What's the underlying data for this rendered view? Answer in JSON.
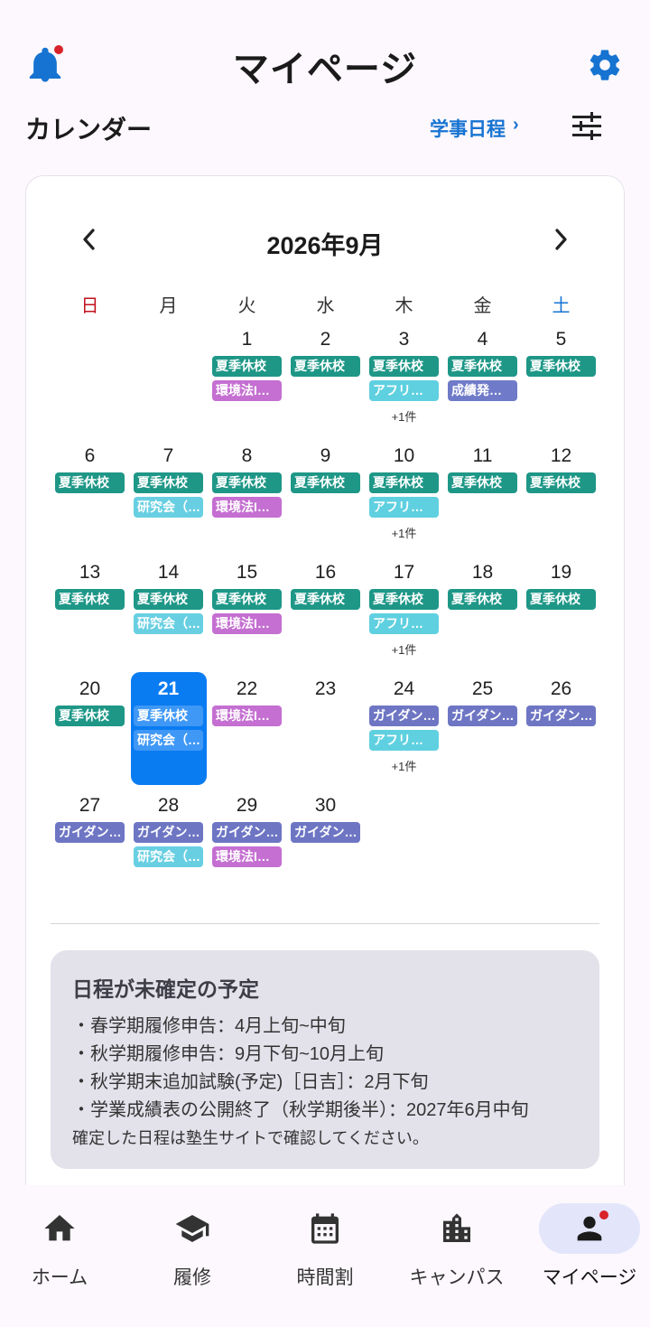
{
  "header": {
    "title": "マイページ"
  },
  "calendar": {
    "section_title": "カレンダー",
    "academic_link": "学事日程",
    "month_label": "2026年9月",
    "weekdays": [
      "日",
      "月",
      "火",
      "水",
      "木",
      "金",
      "土"
    ],
    "colors": {
      "natsu": "#1e9787",
      "kankyo": "#c46fd1",
      "afuri": "#5fd0e0",
      "kenkyu": "#68cfe2",
      "seiseki": "#6f7bc8",
      "guidance": "#6e76c4",
      "sunday": "#c1121f",
      "saturday": "#1673d1",
      "today": "#0a7cf2"
    },
    "days": {
      "1": {
        "num": "1",
        "events": [
          {
            "t": "夏季休校",
            "c": "natsu"
          },
          {
            "t": "環境法I…",
            "c": "kankyo"
          }
        ]
      },
      "2": {
        "num": "2",
        "events": [
          {
            "t": "夏季休校",
            "c": "natsu"
          }
        ]
      },
      "3": {
        "num": "3",
        "events": [
          {
            "t": "夏季休校",
            "c": "natsu"
          },
          {
            "t": "アフリ…",
            "c": "afuri"
          }
        ],
        "more": "+1件"
      },
      "4": {
        "num": "4",
        "events": [
          {
            "t": "夏季休校",
            "c": "natsu"
          },
          {
            "t": "成績発…",
            "c": "seiseki"
          }
        ]
      },
      "5": {
        "num": "5",
        "events": [
          {
            "t": "夏季休校",
            "c": "natsu"
          }
        ]
      },
      "6": {
        "num": "6",
        "events": [
          {
            "t": "夏季休校",
            "c": "natsu"
          }
        ]
      },
      "7": {
        "num": "7",
        "events": [
          {
            "t": "夏季休校",
            "c": "natsu"
          },
          {
            "t": "研究会（…",
            "c": "kenkyu"
          }
        ]
      },
      "8": {
        "num": "8",
        "events": [
          {
            "t": "夏季休校",
            "c": "natsu"
          },
          {
            "t": "環境法I…",
            "c": "kankyo"
          }
        ]
      },
      "9": {
        "num": "9",
        "events": [
          {
            "t": "夏季休校",
            "c": "natsu"
          }
        ]
      },
      "10": {
        "num": "10",
        "events": [
          {
            "t": "夏季休校",
            "c": "natsu"
          },
          {
            "t": "アフリ…",
            "c": "afuri"
          }
        ],
        "more": "+1件"
      },
      "11": {
        "num": "11",
        "events": [
          {
            "t": "夏季休校",
            "c": "natsu"
          }
        ]
      },
      "12": {
        "num": "12",
        "events": [
          {
            "t": "夏季休校",
            "c": "natsu"
          }
        ]
      },
      "13": {
        "num": "13",
        "events": [
          {
            "t": "夏季休校",
            "c": "natsu"
          }
        ]
      },
      "14": {
        "num": "14",
        "events": [
          {
            "t": "夏季休校",
            "c": "natsu"
          },
          {
            "t": "研究会（…",
            "c": "kenkyu"
          }
        ]
      },
      "15": {
        "num": "15",
        "events": [
          {
            "t": "夏季休校",
            "c": "natsu"
          },
          {
            "t": "環境法I…",
            "c": "kankyo"
          }
        ]
      },
      "16": {
        "num": "16",
        "events": [
          {
            "t": "夏季休校",
            "c": "natsu"
          }
        ]
      },
      "17": {
        "num": "17",
        "events": [
          {
            "t": "夏季休校",
            "c": "natsu"
          },
          {
            "t": "アフリ…",
            "c": "afuri"
          }
        ],
        "more": "+1件"
      },
      "18": {
        "num": "18",
        "events": [
          {
            "t": "夏季休校",
            "c": "natsu"
          }
        ]
      },
      "19": {
        "num": "19",
        "events": [
          {
            "t": "夏季休校",
            "c": "natsu"
          }
        ]
      },
      "20": {
        "num": "20",
        "events": [
          {
            "t": "夏季休校",
            "c": "natsu"
          }
        ]
      },
      "21": {
        "num": "21",
        "today": true,
        "events": [
          {
            "t": "夏季休校",
            "c": "today"
          },
          {
            "t": "研究会（…",
            "c": "today"
          }
        ]
      },
      "22": {
        "num": "22",
        "events": [
          {
            "t": "環境法I…",
            "c": "kankyo"
          }
        ]
      },
      "23": {
        "num": "23",
        "events": []
      },
      "24": {
        "num": "24",
        "events": [
          {
            "t": "ガイダン…",
            "c": "guidance"
          },
          {
            "t": "アフリ…",
            "c": "afuri"
          }
        ],
        "more": "+1件"
      },
      "25": {
        "num": "25",
        "events": [
          {
            "t": "ガイダン…",
            "c": "guidance"
          }
        ]
      },
      "26": {
        "num": "26",
        "events": [
          {
            "t": "ガイダン…",
            "c": "guidance"
          }
        ]
      },
      "27": {
        "num": "27",
        "events": [
          {
            "t": "ガイダン…",
            "c": "guidance"
          }
        ]
      },
      "28": {
        "num": "28",
        "events": [
          {
            "t": "ガイダン…",
            "c": "guidance"
          },
          {
            "t": "研究会（…",
            "c": "kenkyu"
          }
        ]
      },
      "29": {
        "num": "29",
        "events": [
          {
            "t": "ガイダン…",
            "c": "guidance"
          },
          {
            "t": "環境法I…",
            "c": "kankyo"
          }
        ]
      },
      "30": {
        "num": "30",
        "events": [
          {
            "t": "ガイダン…",
            "c": "guidance"
          }
        ]
      }
    }
  },
  "note": {
    "title": "日程が未確定の予定",
    "items": [
      "・春学期履修申告：4月上旬~中旬",
      "・秋学期履修申告：9月下旬~10月上旬",
      "・秋学期末追加試験(予定)［日吉］：2月下旬",
      "・学業成績表の公開終了（秋学期後半）：2027年6月中旬"
    ],
    "footer": "確定した日程は塾生サイトで確認してください。"
  },
  "nav": {
    "items": [
      {
        "label": "ホーム",
        "icon": "home-icon"
      },
      {
        "label": "履修",
        "icon": "graduation-cap-icon"
      },
      {
        "label": "時間割",
        "icon": "calendar-icon"
      },
      {
        "label": "キャンパス",
        "icon": "building-icon"
      },
      {
        "label": "マイページ",
        "icon": "person-icon",
        "active": true
      }
    ]
  }
}
